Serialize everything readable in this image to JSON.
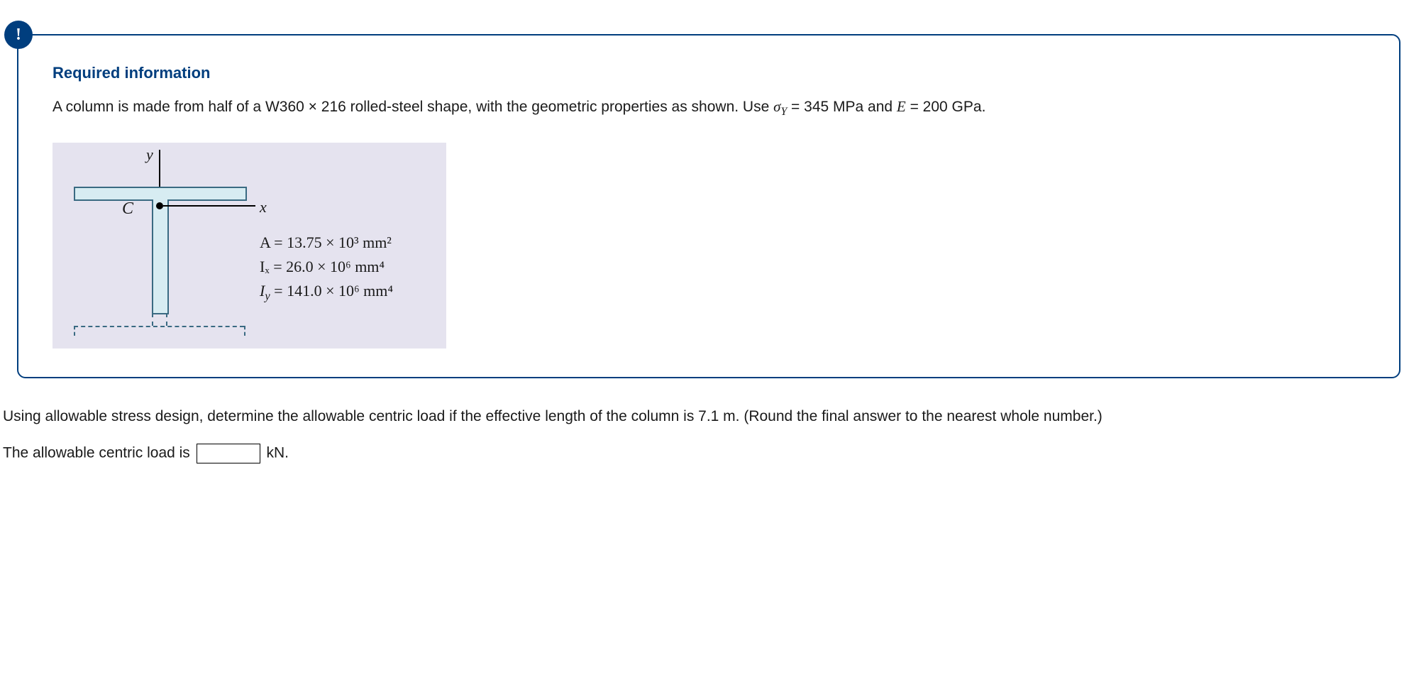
{
  "alert_glyph": "!",
  "heading": "Required information",
  "problem": {
    "line1_pre": "A column is made from half of a W360 × 216 rolled-steel shape, with the geometric properties as shown. Use ",
    "sigma": "σ",
    "sigma_sub": "Y",
    "sigma_val": " = 345 MPa and ",
    "E_sym": "E",
    "E_val": " = 200 GPa."
  },
  "figure": {
    "y_label": "y",
    "x_label": "x",
    "c_label": "C",
    "props": {
      "A": "A = 13.75 × 10³ mm²",
      "Ix": "Iₓ = 26.0 × 10⁶ mm⁴",
      "Iy_pre": "I",
      "Iy_sub": "y",
      "Iy_rest": " = 141.0 × 10⁶ mm⁴"
    }
  },
  "question": "Using allowable stress design, determine the allowable centric load if the effective length of the column is 7.1 m. (Round the final answer to the nearest whole number.)",
  "answer_prompt_pre": "The allowable centric load is ",
  "answer_unit": " kN.",
  "answer_value": ""
}
